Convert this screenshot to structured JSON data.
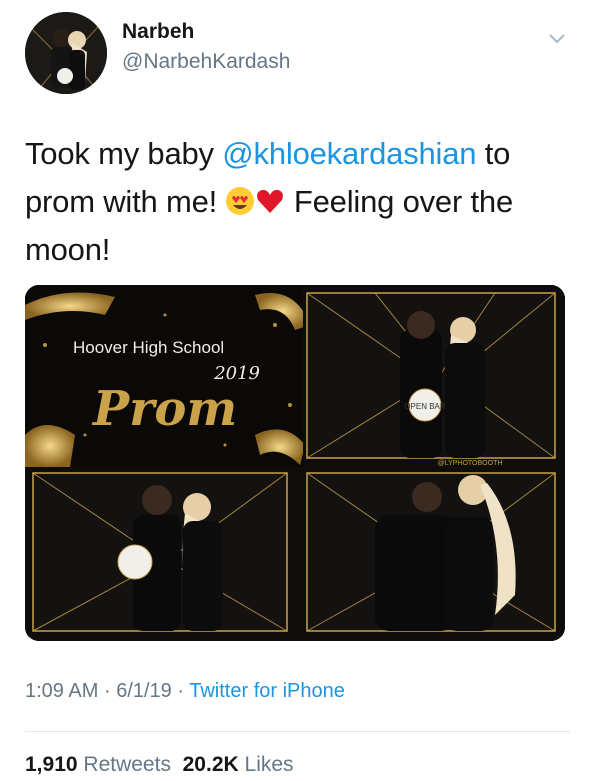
{
  "user": {
    "name": "Narbeh",
    "handle": "@NarbehKardash"
  },
  "tweet": {
    "text_part1": "Took my baby ",
    "mention": "@khloekardashian",
    "text_part2": " to prom with me! ",
    "text_part3": " Feeling over the moon!"
  },
  "media": {
    "banner_line1": "Hoover High School",
    "banner_year": "2019",
    "banner_title": "Prom",
    "sign_text": "OPEN BAR",
    "booth_credit": "@LYPHOTOBOOTH"
  },
  "meta": {
    "time": "1:09 AM",
    "date": "6/1/19",
    "source": "Twitter for iPhone"
  },
  "stats": {
    "retweets_count": "1,910",
    "retweets_label": "Retweets",
    "likes_count": "20.2K",
    "likes_label": "Likes"
  },
  "colors": {
    "link": "#1b95e0",
    "secondary_text": "#657786",
    "gold": "#c9a24a"
  }
}
